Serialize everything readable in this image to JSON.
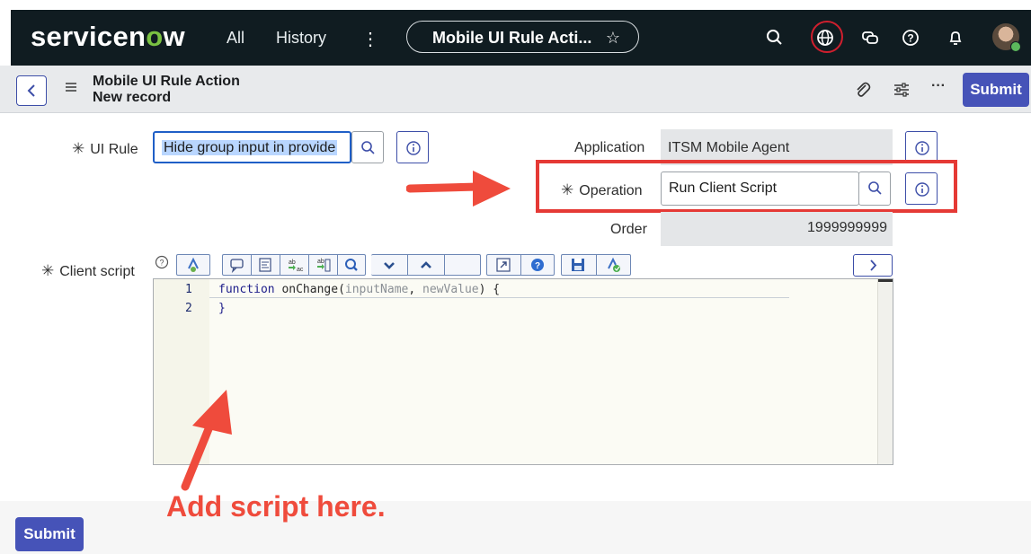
{
  "nav": {
    "logo_text_a": "servicen",
    "logo_text_o": "o",
    "logo_text_b": "w",
    "all": "All",
    "history": "History",
    "more": "⋮",
    "tab_title": "Mobile UI Rule Acti...",
    "star": "☆",
    "icons": [
      "search-icon",
      "globe-icon",
      "chat-icon",
      "help-icon",
      "bell-icon",
      "avatar"
    ]
  },
  "header": {
    "title": "Mobile UI Rule Action",
    "subtitle": "New record",
    "more": "···",
    "submit_label": "Submit"
  },
  "form": {
    "ui_rule": {
      "label": "UI Rule",
      "value": "Hide group input in provide"
    },
    "application": {
      "label": "Application",
      "value": "ITSM Mobile Agent"
    },
    "operation": {
      "label": "Operation",
      "value": "Run Client Script"
    },
    "order": {
      "label": "Order",
      "value": "1999999999"
    },
    "client_script": {
      "label": "Client script"
    },
    "required_mark": "✳"
  },
  "editor": {
    "lines": [
      {
        "num": "1",
        "kw": "function ",
        "name": "onChange(",
        "p1": "inputName",
        "sep": ", ",
        "p2": "newValue",
        "end": ") {"
      },
      {
        "num": "2",
        "kw": "}",
        "name": "",
        "p1": "",
        "sep": "",
        "p2": "",
        "end": ""
      }
    ]
  },
  "annotation": {
    "text": "Add script here."
  },
  "footer": {
    "submit_label": "Submit"
  },
  "colors": {
    "nav_bg": "#101c21",
    "accent": "#4653b8",
    "highlight_red": "#e53935",
    "annotation_red": "#ef4b3c"
  }
}
